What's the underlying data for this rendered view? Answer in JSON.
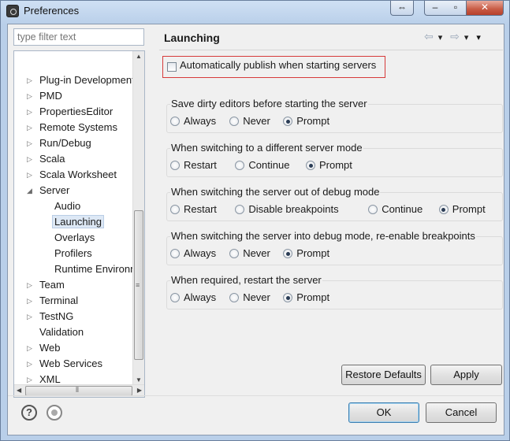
{
  "window": {
    "title": "Preferences"
  },
  "filter": {
    "placeholder": "type filter text"
  },
  "tree": {
    "items": [
      {
        "label": "Plug-in Development",
        "arrow": "▷"
      },
      {
        "label": "PMD",
        "arrow": "▷"
      },
      {
        "label": "PropertiesEditor",
        "arrow": "▷"
      },
      {
        "label": "Remote Systems",
        "arrow": "▷"
      },
      {
        "label": "Run/Debug",
        "arrow": "▷"
      },
      {
        "label": "Scala",
        "arrow": "▷"
      },
      {
        "label": "Scala Worksheet",
        "arrow": "▷"
      },
      {
        "label": "Server",
        "arrow": "◢"
      },
      {
        "label": "Audio",
        "arrow": ""
      },
      {
        "label": "Launching",
        "arrow": ""
      },
      {
        "label": "Overlays",
        "arrow": ""
      },
      {
        "label": "Profilers",
        "arrow": ""
      },
      {
        "label": "Runtime Environm",
        "arrow": ""
      },
      {
        "label": "Team",
        "arrow": "▷"
      },
      {
        "label": "Terminal",
        "arrow": "▷"
      },
      {
        "label": "TestNG",
        "arrow": "▷"
      },
      {
        "label": "Validation",
        "arrow": ""
      },
      {
        "label": "Web",
        "arrow": "▷"
      },
      {
        "label": "Web Services",
        "arrow": "▷"
      },
      {
        "label": "XML",
        "arrow": "▷"
      }
    ]
  },
  "page": {
    "title": "Launching",
    "auto_publish_label": "Automatically publish when starting servers"
  },
  "groups": [
    {
      "title": "Save dirty editors before starting the server",
      "options": [
        "Always",
        "Never",
        "Prompt"
      ],
      "selected": "Prompt"
    },
    {
      "title": "When switching to a different server mode",
      "options": [
        "Restart",
        "Continue",
        "Prompt"
      ],
      "selected": "Prompt"
    },
    {
      "title": "When switching the server out of debug mode",
      "options": [
        "Restart",
        "Disable breakpoints",
        "Continue",
        "Prompt"
      ],
      "selected": "Prompt"
    },
    {
      "title": "When switching the server into debug mode, re-enable breakpoints",
      "options": [
        "Always",
        "Never",
        "Prompt"
      ],
      "selected": "Prompt"
    },
    {
      "title": "When required, restart the server",
      "options": [
        "Always",
        "Never",
        "Prompt"
      ],
      "selected": "Prompt"
    }
  ],
  "buttons": {
    "restore_defaults": "Restore Defaults",
    "apply": "Apply",
    "ok": "OK",
    "cancel": "Cancel"
  },
  "icons": {
    "back": "⇦",
    "forward": "⇨",
    "dropdown": "▾",
    "help": "?"
  }
}
